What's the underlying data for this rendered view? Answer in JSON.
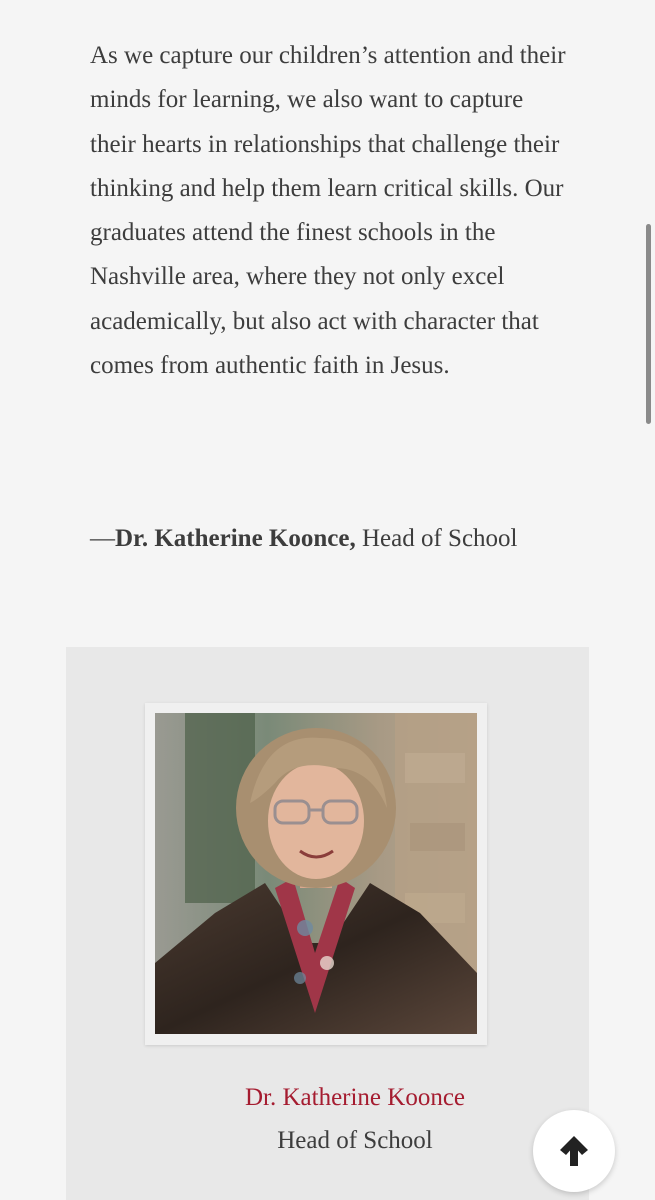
{
  "quote": {
    "text": "As we capture our children’s attention and their minds for learning, we also want to capture their hearts in relationships that challenge their thinking and help them learn critical skills. Our graduates attend the finest schools in the Nashville area, where they not only excel academically, but also act with character that comes from authentic faith in Jesus."
  },
  "attribution": {
    "dash": "—",
    "name": "Dr. Katherine Koonce,",
    "role": " Head of School"
  },
  "profile": {
    "photo_alt": "Dr. Katherine Koonce",
    "name": "Dr. Katherine Koonce",
    "role": "Head of School"
  },
  "controls": {
    "back_to_top_icon": "arrow-up-icon"
  },
  "colors": {
    "accent": "#a51c30",
    "text": "#3d3d3d",
    "background": "#f5f5f5",
    "card_background": "#e8e8e8"
  }
}
